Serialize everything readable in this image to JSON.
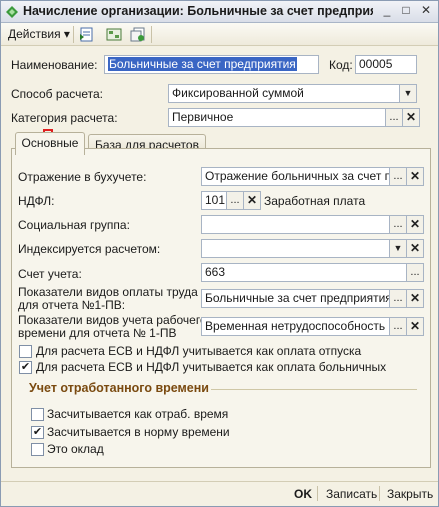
{
  "window": {
    "title": "Начисление организации: Больничные за счет предприя"
  },
  "toolbar": {
    "actions_label": "Действия",
    "actions_arrow": "▾"
  },
  "header": {
    "name_label": "Наименование:",
    "name_value": "Больничные за счет предприятия",
    "code_label": "Код:",
    "code_value": "00005",
    "method_label": "Способ расчета:",
    "method_value": "Фиксированной суммой",
    "category_label": "Категория расчета:",
    "category_value": "Первичное"
  },
  "tabs": [
    {
      "label": "Основные",
      "active": true
    },
    {
      "label": "База для расчетов",
      "active": false
    }
  ],
  "main": {
    "accounting_label": "Отражение в бухучете:",
    "accounting_value": "Отражение больничных за счет пре,",
    "ndfl_label": "НДФЛ:",
    "ndfl_value": "101",
    "ndfl_desc": "Заработная плата",
    "social_label": "Социальная группа:",
    "social_value": "",
    "indexed_label": "Индексируется расчетом:",
    "indexed_value": "",
    "account_label": "Счет учета:",
    "account_value": "663",
    "pay_types_label_1": "Показатели видов оплаты труда",
    "pay_types_label_2": "для отчета №1-ПВ:",
    "pay_types_value": "Больничные за счет предприятия",
    "time_types_label_1": "Показатели видов учета рабочего",
    "time_types_label_2": "времени для отчета № 1-ПВ",
    "time_types_value": "Временная нетрудоспособность",
    "check_vacation_label": "Для расчета ЕСВ и НДФЛ учитывается как оплата отпуска",
    "check_vacation": false,
    "check_sick_label": "Для расчета ЕСВ и НДФЛ учитывается как оплата больничных",
    "check_sick": true
  },
  "worktime": {
    "title": "Учет отработанного времени",
    "items": [
      {
        "label": "Засчитывается как отраб. время",
        "checked": false
      },
      {
        "label": "Засчитывается в норму времени",
        "checked": true
      },
      {
        "label": "Это оклад",
        "checked": false
      }
    ]
  },
  "footer": {
    "ok_label": "OK",
    "save_label": "Записать",
    "close_label": "Закрыть"
  },
  "glyphs": {
    "ellipsis": "...",
    "clear": "✕",
    "dropdown": "▼",
    "check": "✔"
  },
  "colors": {
    "selection": "#3a66c4",
    "group_title": "#7a4a10",
    "arrow": "#e02020"
  }
}
